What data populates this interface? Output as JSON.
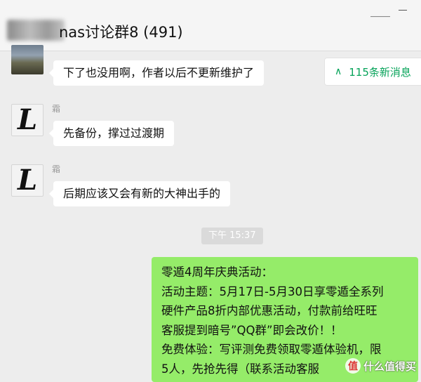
{
  "header": {
    "title": "nas讨论群8 (491)",
    "pin_icon": "pin-icon",
    "minimize_icon": "minimize-icon"
  },
  "new_messages": {
    "label": "115条新消息",
    "icon": "chevron-up-double-icon"
  },
  "messages": [
    {
      "sender": "",
      "text": "下了也没用啊，作者以后不更新维护了"
    },
    {
      "sender": "霜",
      "text": "先备份，撑过过渡期"
    },
    {
      "sender": "霜",
      "text": "后期应该又会有新的大神出手的"
    }
  ],
  "timestamp": "下午 15:37",
  "own_message": {
    "lines": [
      "零遁4周年庆典活动：",
      "活动主题：5月17日-5月30日享零遁全系列",
      "硬件产品8折内部优惠活动，付款前给旺旺",
      "客服提到暗号”QQ群”即会改价！！",
      "免费体验：写评测免费领取零遁体验机，限",
      "5人，先抢先得（联系活动客服"
    ]
  },
  "watermark": {
    "badge": "值",
    "text": "什么值得买"
  },
  "colors": {
    "background": "#ededed",
    "own_bubble": "#95ec69",
    "accent_green": "#07a35a"
  }
}
